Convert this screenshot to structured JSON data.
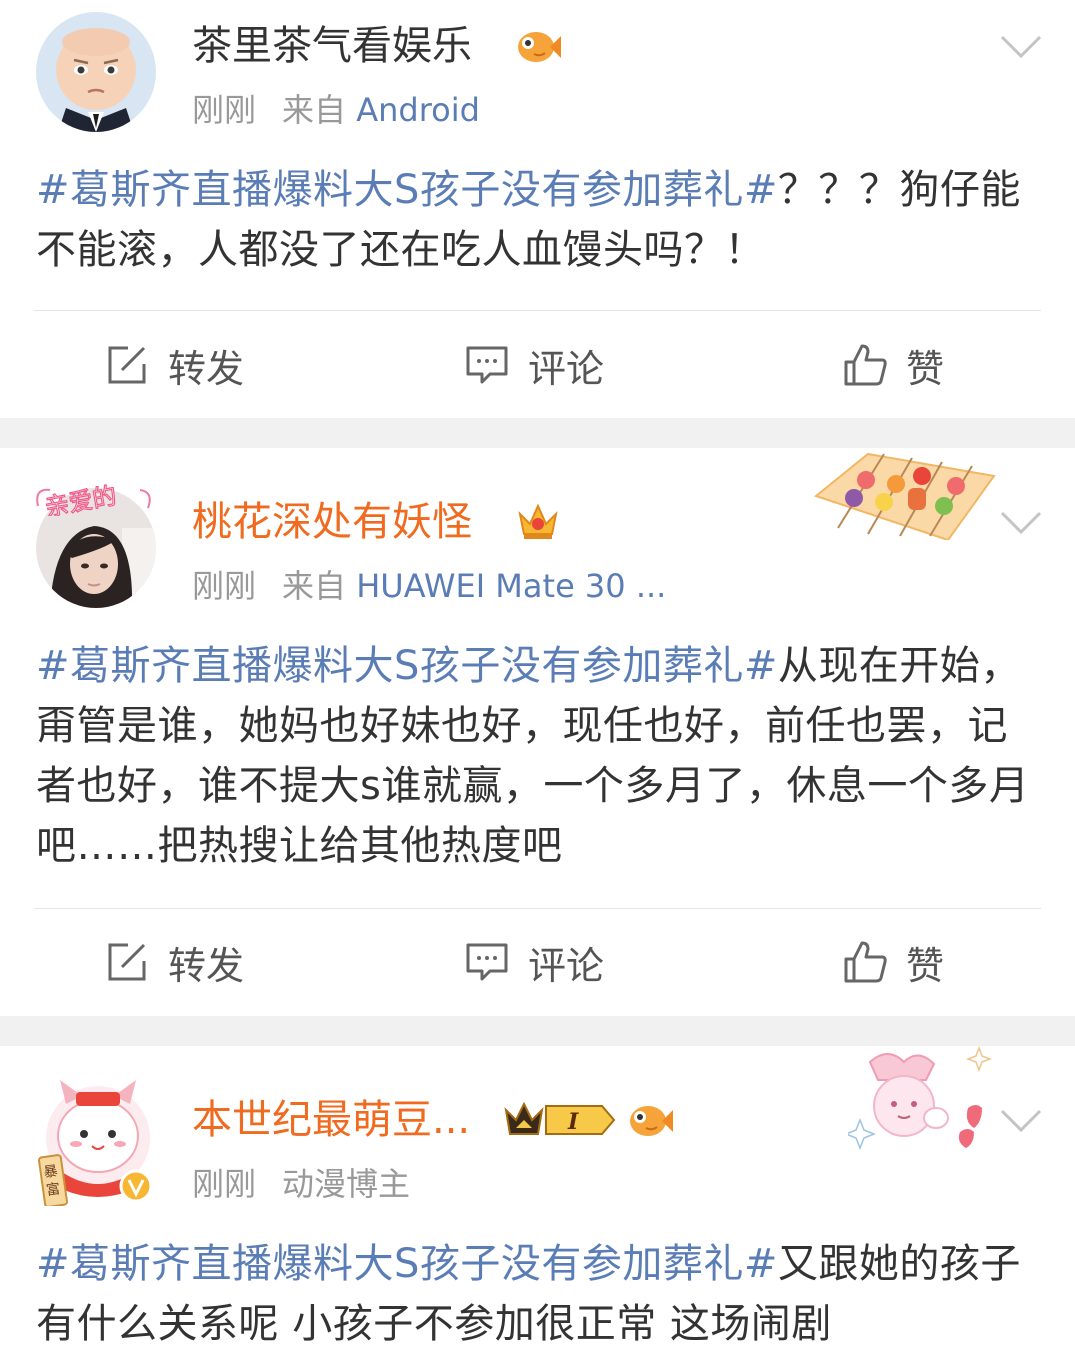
{
  "posts": [
    {
      "username": "茶里茶气看娱乐",
      "time": "刚刚",
      "source_prefix": "来自",
      "source": "Android",
      "topic": "#葛斯齐直播爆料大S孩子没有参加葬礼#",
      "content": "？？？狗仔能不能滚，人都没了还在吃人血馒头吗？！"
    },
    {
      "username": "桃花深处有妖怪",
      "time": "刚刚",
      "source_prefix": "来自",
      "source": "HUAWEI Mate 30 ...",
      "topic": "#葛斯齐直播爆料大S孩子没有参加葬礼#",
      "content": "从现在开始，甭管是谁，她妈也好妹也好，现任也好，前任也罢，记者也好，谁不提大s谁就赢，一个多月了，休息一个多月吧……把热搜让给其他热度吧"
    },
    {
      "username": "本世纪最萌豆...",
      "time": "刚刚",
      "tag": "动漫博主",
      "topic": "#葛斯齐直播爆料大S孩子没有参加葬礼#",
      "content": "又跟她的孩子有什么关系呢 小孩子不参加很正常 这场闹剧"
    }
  ],
  "actions": {
    "repost": "转发",
    "comment": "评论",
    "like": "赞"
  },
  "badges": {
    "vip_level": "I",
    "avatar_sticker_text": "亲爱的",
    "avatar_tag_text": "暴富"
  },
  "colors": {
    "topic_blue": "#5b7db6",
    "vip_orange": "#f06a1f",
    "text": "#333333",
    "meta_gray": "#999999",
    "separator": "#f1f1f1"
  },
  "icons": [
    "fish-icon",
    "crown-icon",
    "chevron-down-icon",
    "repost-icon",
    "comment-icon",
    "like-icon"
  ]
}
